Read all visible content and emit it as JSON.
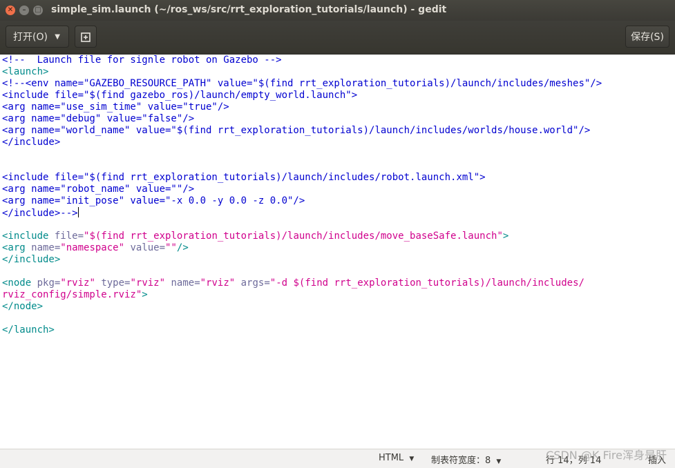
{
  "window": {
    "title": "simple_sim.launch (~/ros_ws/src/rrt_exploration_tutorials/launch) - gedit"
  },
  "toolbar": {
    "open_label": "打开(O)",
    "new_tab_icon": "new-document-icon",
    "save_label": "保存(S)"
  },
  "editor": {
    "lines": [
      [
        {
          "t": "<!--  Launch file for signle robot on Gazebo -->",
          "c": "comment"
        }
      ],
      [
        {
          "t": "<launch>",
          "c": "tag"
        }
      ],
      [
        {
          "t": "<!--<env name=\"GAZEBO_RESOURCE_PATH\" value=\"$(find rrt_exploration_tutorials)/launch/includes/meshes\"/>",
          "c": "comment"
        }
      ],
      [
        {
          "t": "<include file=\"$(find gazebo_ros)/launch/empty_world.launch\">",
          "c": "comment"
        }
      ],
      [
        {
          "t": "<arg name=\"use_sim_time\" value=\"true\"/>",
          "c": "comment"
        }
      ],
      [
        {
          "t": "<arg name=\"debug\" value=\"false\"/>",
          "c": "comment"
        }
      ],
      [
        {
          "t": "<arg name=\"world_name\" value=\"$(find rrt_exploration_tutorials)/launch/includes/worlds/house.world\"/>",
          "c": "comment"
        }
      ],
      [
        {
          "t": "</include>",
          "c": "comment"
        }
      ],
      [],
      [],
      [
        {
          "t": "<include file=\"$(find rrt_exploration_tutorials)/launch/includes/robot.launch.xml\">",
          "c": "comment"
        }
      ],
      [
        {
          "t": "<arg name=\"robot_name\" value=\"\"/>",
          "c": "comment"
        }
      ],
      [
        {
          "t": "<arg name=\"init_pose\" value=\"-x 0.0 -y 0.0 -z 0.0\"/>",
          "c": "comment"
        }
      ],
      [
        {
          "t": "</include>-->",
          "c": "comment"
        }
      ],
      [],
      [
        {
          "t": "<include",
          "c": "tag"
        },
        {
          "t": " file=",
          "c": "attr"
        },
        {
          "t": "\"$(find rrt_exploration_tutorials)/launch/includes/move_baseSafe.launch\"",
          "c": "str"
        },
        {
          "t": ">",
          "c": "tag"
        }
      ],
      [
        {
          "t": "<arg",
          "c": "tag"
        },
        {
          "t": " name=",
          "c": "attr"
        },
        {
          "t": "\"namespace\"",
          "c": "str"
        },
        {
          "t": " value=",
          "c": "attr"
        },
        {
          "t": "\"\"",
          "c": "str"
        },
        {
          "t": "/>",
          "c": "tag"
        }
      ],
      [
        {
          "t": "</include>",
          "c": "tag"
        }
      ],
      [],
      [
        {
          "t": "<node",
          "c": "tag"
        },
        {
          "t": " pkg=",
          "c": "attr"
        },
        {
          "t": "\"rviz\"",
          "c": "str"
        },
        {
          "t": " type=",
          "c": "attr"
        },
        {
          "t": "\"rviz\"",
          "c": "str"
        },
        {
          "t": " name=",
          "c": "attr"
        },
        {
          "t": "\"rviz\"",
          "c": "str"
        },
        {
          "t": " args=",
          "c": "attr"
        },
        {
          "t": "\"-d $(find rrt_exploration_tutorials)/launch/includes/",
          "c": "str"
        }
      ],
      [
        {
          "t": "rviz_config/simple.rviz\"",
          "c": "str"
        },
        {
          "t": ">",
          "c": "tag"
        }
      ],
      [
        {
          "t": "</node>",
          "c": "tag"
        }
      ],
      [],
      [
        {
          "t": "</launch>",
          "c": "tag"
        }
      ]
    ],
    "cursor_line": 14
  },
  "status": {
    "language": "HTML",
    "tab_width": "制表符宽度：8",
    "position": "行 14，列 14",
    "mode": "插入"
  },
  "watermark": "CSDN @K Fire浑身是肝",
  "colors": {
    "comment": "#0000d0",
    "tag": "#008a8a",
    "attr": "#6d6a9a",
    "string": "#d0008c"
  }
}
